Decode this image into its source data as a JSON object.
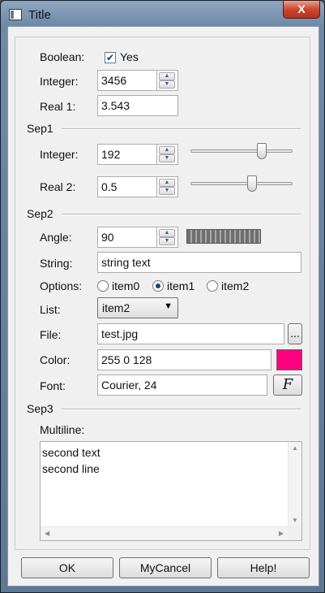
{
  "window": {
    "title": "Title",
    "close_glyph": "X",
    "icon": "window-app-icon"
  },
  "boolean": {
    "label": "Boolean:",
    "checkbox_text": "Yes",
    "checked": true
  },
  "integer1": {
    "label": "Integer:",
    "value": "3456"
  },
  "real1": {
    "label": "Real 1:",
    "value": "3.543"
  },
  "sep1": {
    "label": "Sep1"
  },
  "integer2": {
    "label": "Integer:",
    "value": "192",
    "slider_fraction": 0.72
  },
  "real2": {
    "label": "Real 2:",
    "value": "0.5",
    "slider_fraction": 0.61
  },
  "sep2": {
    "label": "Sep2"
  },
  "angle": {
    "label": "Angle:",
    "value": "90"
  },
  "string": {
    "label": "String:",
    "value": "string text"
  },
  "options": {
    "label": "Options:",
    "items": [
      "item0",
      "item1",
      "item2"
    ],
    "selected": "item1"
  },
  "list": {
    "label": "List:",
    "value": "item2"
  },
  "file": {
    "label": "File:",
    "value": "test.jpg",
    "browse_label": "..."
  },
  "color": {
    "label": "Color:",
    "value": "255 0 128",
    "swatch": "#ff0080"
  },
  "font": {
    "label": "Font:",
    "value": "Courier, 24",
    "button_label": "F"
  },
  "sep3": {
    "label": "Sep3"
  },
  "multiline": {
    "label": "Multiline:",
    "lines": [
      "second text",
      "second line"
    ]
  },
  "buttons": {
    "ok": "OK",
    "cancel": "MyCancel",
    "help": "Help!"
  }
}
